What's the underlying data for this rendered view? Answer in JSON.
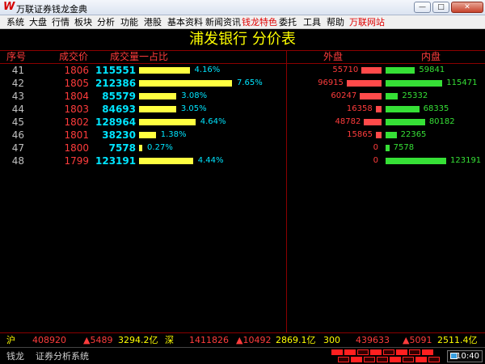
{
  "window": {
    "title": "万联证券钱龙金典",
    "logo": "W",
    "controls": {
      "minimize": "—",
      "maximize": "□",
      "close": "✕"
    }
  },
  "menu": {
    "items": [
      "系统",
      "大盘",
      "行情",
      "板块",
      "分析",
      "功能",
      "港股",
      "基本资料",
      "新闻资讯",
      "钱龙特色",
      "委托",
      "工具",
      "帮助",
      "万联网站"
    ],
    "highlighted": [
      "钱龙特色",
      "万联网站"
    ]
  },
  "main": {
    "title": "浦发银行    分价表",
    "headers": {
      "seq": "序号",
      "price": "成交价",
      "volume_share": "成交量一占比",
      "outer": "外盘",
      "inner": "内盘"
    },
    "rows": [
      {
        "seq": "41",
        "price": "1806",
        "volume": "115551",
        "pct": "4.16%",
        "outer": "55710",
        "inner": "59841"
      },
      {
        "seq": "42",
        "price": "1805",
        "volume": "212386",
        "pct": "7.65%",
        "outer": "96915",
        "inner": "115471"
      },
      {
        "seq": "43",
        "price": "1804",
        "volume": "85579",
        "pct": "3.08%",
        "outer": "60247",
        "inner": "25332"
      },
      {
        "seq": "44",
        "price": "1803",
        "volume": "84693",
        "pct": "3.05%",
        "outer": "16358",
        "inner": "68335"
      },
      {
        "seq": "45",
        "price": "1802",
        "volume": "128964",
        "pct": "4.64%",
        "outer": "48782",
        "inner": "80182"
      },
      {
        "seq": "46",
        "price": "1801",
        "volume": "38230",
        "pct": "1.38%",
        "outer": "15865",
        "inner": "22365"
      },
      {
        "seq": "47",
        "price": "1800",
        "volume": "7578",
        "pct": "0.27%",
        "outer": "0",
        "inner": "7578"
      },
      {
        "seq": "48",
        "price": "1799",
        "volume": "123191",
        "pct": "4.44%",
        "outer": "0",
        "inner": "123191"
      }
    ]
  },
  "status": {
    "sh": {
      "label": "沪",
      "index": "408920",
      "change": "▲5489",
      "amount": "3294.2亿"
    },
    "sz": {
      "label": "深",
      "index": "1411826",
      "change": "▲10492",
      "amount": "2869.1亿"
    },
    "i300": {
      "label": "300",
      "index": "439633",
      "change": "▲5091",
      "amount": "2511.4亿"
    }
  },
  "bottom": {
    "brand": "钱龙",
    "system": "证券分析系统",
    "time": "10:40"
  },
  "colors": {
    "up": "#ff3c3c",
    "down": "#36e036",
    "volume": "#00e5ff",
    "bar": "#ffff40",
    "title": "#ffff00",
    "grid": "#8b0000"
  }
}
